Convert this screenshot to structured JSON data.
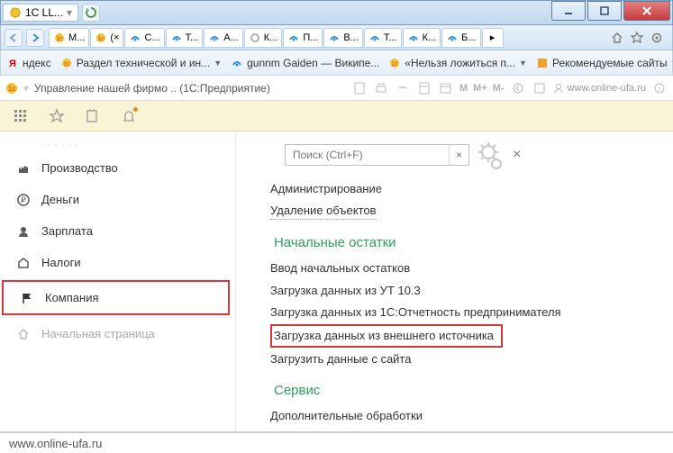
{
  "window": {
    "title": "1C LL...",
    "min": "min",
    "max": "max",
    "close": "close"
  },
  "browser_tabs": [
    {
      "label": "М...",
      "icon": "1c"
    },
    {
      "label": "(×",
      "icon": "1c"
    },
    {
      "label": "С...",
      "icon": "ie"
    },
    {
      "label": "Т...",
      "icon": "ie"
    },
    {
      "label": "А...",
      "icon": "ie"
    },
    {
      "label": "К...",
      "icon": "gear"
    },
    {
      "label": "П...",
      "icon": "ie"
    },
    {
      "label": "В...",
      "icon": "ie"
    },
    {
      "label": "Т...",
      "icon": "ie"
    },
    {
      "label": "К...",
      "icon": "ie"
    },
    {
      "label": "Б...",
      "icon": "ie"
    }
  ],
  "bookmarks": [
    {
      "label": "ндекс",
      "icon": "yandex",
      "drop": false
    },
    {
      "label": "Раздел технической и ин...",
      "icon": "1c-red",
      "drop": true
    },
    {
      "label": "gunnm Gaiden — Википе...",
      "icon": "ie",
      "drop": false
    },
    {
      "label": "«Нельзя ложиться п...",
      "icon": "1c-red",
      "drop": true
    },
    {
      "label": "Рекомендуемые сайты",
      "icon": "orange",
      "drop": true
    }
  ],
  "onec": {
    "title": "Управление нашей фирмо .. (1С:Предприятие)",
    "m": "M",
    "mp": "M+",
    "mm": "M-",
    "user": "www.online-ufa.ru"
  },
  "search": {
    "placeholder": "Поиск (Ctrl+F)",
    "clear": "×",
    "close": "×"
  },
  "sidebar": {
    "items": [
      {
        "label": "Производство",
        "icon": "factory"
      },
      {
        "label": "Деньги",
        "icon": "ruble"
      },
      {
        "label": "Зарплата",
        "icon": "person"
      },
      {
        "label": "Налоги",
        "icon": "tax"
      },
      {
        "label": "Компания",
        "icon": "flag",
        "highlight": true
      },
      {
        "label": "Начальная страница",
        "icon": "home",
        "muted": true
      }
    ]
  },
  "content": {
    "top_items": [
      "Администрирование",
      "Удаление объектов"
    ],
    "section1": {
      "title": "Начальные остатки",
      "items": [
        "Ввод начальных остатков",
        "Загрузка данных из УТ 10.3",
        "Загрузка данных из 1С:Отчетность предпринимателя",
        "Загрузка данных из внешнего источника",
        "Загрузить данные с сайта"
      ],
      "highlight_index": 3
    },
    "section2": {
      "title": "Сервис",
      "items": [
        "Дополнительные обработки"
      ]
    }
  },
  "footer": {
    "url": "www.online-ufa.ru"
  }
}
